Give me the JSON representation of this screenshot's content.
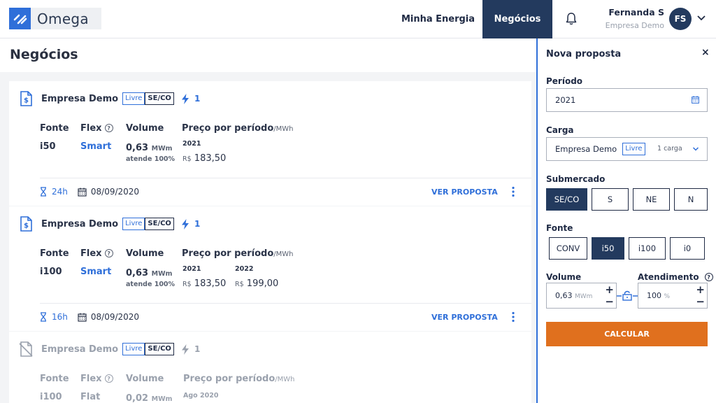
{
  "header": {
    "logo_text": "Omega",
    "nav": [
      {
        "label": "Minha Energia",
        "active": false
      },
      {
        "label": "Negócios",
        "active": true
      }
    ],
    "user": {
      "name": "Fernanda S",
      "company": "Empresa Demo",
      "initials": "FS"
    }
  },
  "page": {
    "title": "Negócios"
  },
  "labels": {
    "fonte": "Fonte",
    "flex": "Flex",
    "volume": "Volume",
    "preco": "Preço por período",
    "preco_unit": "/MWh",
    "vol_unit": "MWm",
    "ver_proposta": "VER PROPOSTA",
    "help": "?"
  },
  "cards": [
    {
      "company": "Empresa Demo",
      "mercado": "Livre",
      "submercado": "SE/CO",
      "qty": "1",
      "fonte": "i50",
      "flex": "Smart",
      "volume": "0,63",
      "atende": "atende 100%",
      "prices": [
        {
          "year": "2021",
          "currency": "R$",
          "value": "183,50"
        }
      ],
      "hours": "24h",
      "date": "08/09/2020"
    },
    {
      "company": "Empresa Demo",
      "mercado": "Livre",
      "submercado": "SE/CO",
      "qty": "1",
      "fonte": "i100",
      "flex": "Smart",
      "volume": "0,63",
      "atende": "atende 100%",
      "prices": [
        {
          "year": "2021",
          "currency": "R$",
          "value": "183,50"
        },
        {
          "year": "2022",
          "currency": "R$",
          "value": "199,00"
        }
      ],
      "hours": "16h",
      "date": "08/09/2020"
    },
    {
      "company": "Empresa Demo",
      "mercado": "Livre",
      "submercado": "SE/CO",
      "qty": "1",
      "fonte": "i100",
      "flex": "Flat",
      "volume": "0,02",
      "prices": [
        {
          "year": "Ago 2020"
        }
      ]
    }
  ],
  "panel": {
    "title": "Nova proposta",
    "close": "×",
    "periodo_label": "Período",
    "periodo_value": "2021",
    "carga_label": "Carga",
    "carga_company": "Empresa Demo",
    "carga_mercado": "Livre",
    "carga_count": "1 carga",
    "submercado_label": "Submercado",
    "submercados": [
      "SE/CO",
      "S",
      "NE",
      "N"
    ],
    "submercado_selected": "SE/CO",
    "fonte_label": "Fonte",
    "fontes": [
      "CONV",
      "i50",
      "i100",
      "i0"
    ],
    "fonte_selected": "i50",
    "volume_label": "Volume",
    "volume_value": "0,63",
    "volume_unit": "MWm",
    "atendimento_label": "Atendimento",
    "atendimento_value": "100",
    "atendimento_unit": "%",
    "plus": "+",
    "minus": "−",
    "calcular": "CALCULAR"
  },
  "colors": {
    "accent": "#2f6fd9",
    "navy": "#233a5e",
    "orange": "#e0701e"
  }
}
